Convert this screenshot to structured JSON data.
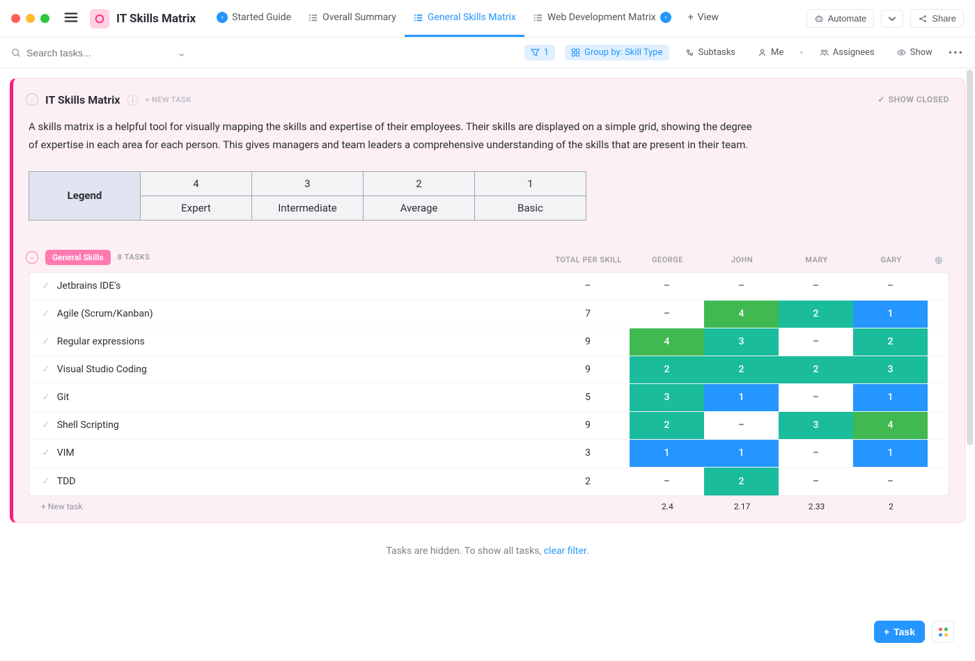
{
  "app": {
    "title": "IT Skills Matrix"
  },
  "tabs": {
    "started": {
      "label": "Started Guide"
    },
    "summary": {
      "label": "Overall Summary"
    },
    "general": {
      "label": "General Skills Matrix"
    },
    "webdev": {
      "label": "Web Development Matrix"
    },
    "addview": {
      "label": "View"
    }
  },
  "titlebar_actions": {
    "automate": "Automate",
    "share": "Share"
  },
  "toolbar": {
    "search_placeholder": "Search tasks...",
    "filter_count": "1",
    "group_by": "Group by: Skill Type",
    "subtasks": "Subtasks",
    "me": "Me",
    "assignees": "Assignees",
    "show": "Show"
  },
  "card": {
    "title": "IT Skills Matrix",
    "new_task": "+ NEW TASK",
    "show_closed": "SHOW CLOSED",
    "description": "A skills matrix is a helpful tool for visually mapping the skills and expertise of their employees. Their skills are displayed on a simple grid, showing the degree of expertise in each area for each person. This gives managers and team leaders a comprehensive understanding of the skills that are present in their team."
  },
  "legend": {
    "header": "Legend",
    "cols": [
      "4",
      "3",
      "2",
      "1"
    ],
    "labels": [
      "Expert",
      "Intermediate",
      "Average",
      "Basic"
    ]
  },
  "group": {
    "pill": "General Skills",
    "count": "8 TASKS"
  },
  "columns": {
    "total": "TOTAL PER SKILL",
    "people": [
      "GEORGE",
      "JOHN",
      "MARY",
      "GARY"
    ]
  },
  "rows": [
    {
      "name": "Jetbrains IDE's",
      "total": "–",
      "cells": [
        {
          "v": "–"
        },
        {
          "v": "–"
        },
        {
          "v": "–"
        },
        {
          "v": "–"
        }
      ]
    },
    {
      "name": "Agile (Scrum/Kanban)",
      "total": "7",
      "cells": [
        {
          "v": "–"
        },
        {
          "v": "4",
          "c": "green"
        },
        {
          "v": "2",
          "c": "teal"
        },
        {
          "v": "1",
          "c": "blue"
        }
      ]
    },
    {
      "name": "Regular expressions",
      "total": "9",
      "cells": [
        {
          "v": "4",
          "c": "green"
        },
        {
          "v": "3",
          "c": "teal"
        },
        {
          "v": "–"
        },
        {
          "v": "2",
          "c": "teal"
        }
      ]
    },
    {
      "name": "Visual Studio Coding",
      "total": "9",
      "cells": [
        {
          "v": "2",
          "c": "teal"
        },
        {
          "v": "2",
          "c": "teal"
        },
        {
          "v": "2",
          "c": "teal"
        },
        {
          "v": "3",
          "c": "teal"
        }
      ]
    },
    {
      "name": "Git",
      "total": "5",
      "cells": [
        {
          "v": "3",
          "c": "teal"
        },
        {
          "v": "1",
          "c": "blue"
        },
        {
          "v": "–"
        },
        {
          "v": "1",
          "c": "blue"
        }
      ]
    },
    {
      "name": "Shell Scripting",
      "total": "9",
      "cells": [
        {
          "v": "2",
          "c": "teal"
        },
        {
          "v": "–"
        },
        {
          "v": "3",
          "c": "teal"
        },
        {
          "v": "4",
          "c": "green"
        }
      ]
    },
    {
      "name": "VIM",
      "total": "3",
      "cells": [
        {
          "v": "1",
          "c": "blue"
        },
        {
          "v": "1",
          "c": "blue"
        },
        {
          "v": "–"
        },
        {
          "v": "1",
          "c": "blue"
        }
      ]
    },
    {
      "name": "TDD",
      "total": "2",
      "cells": [
        {
          "v": "–"
        },
        {
          "v": "2",
          "c": "teal"
        },
        {
          "v": "–"
        },
        {
          "v": "–"
        }
      ]
    }
  ],
  "footer": {
    "new_task": "+ New task",
    "avgs": [
      "2.4",
      "2.17",
      "2.33",
      "2"
    ]
  },
  "hidden_note": {
    "prefix": "Tasks are hidden. To show all tasks, ",
    "link": "clear filter",
    "suffix": "."
  },
  "fab": {
    "task": "Task"
  },
  "colors": {
    "green": "#3fb950",
    "teal": "#1bbc9b",
    "blue": "#2596ff",
    "pink": "#ff7ab1",
    "magenta": "#ff1a7a"
  }
}
